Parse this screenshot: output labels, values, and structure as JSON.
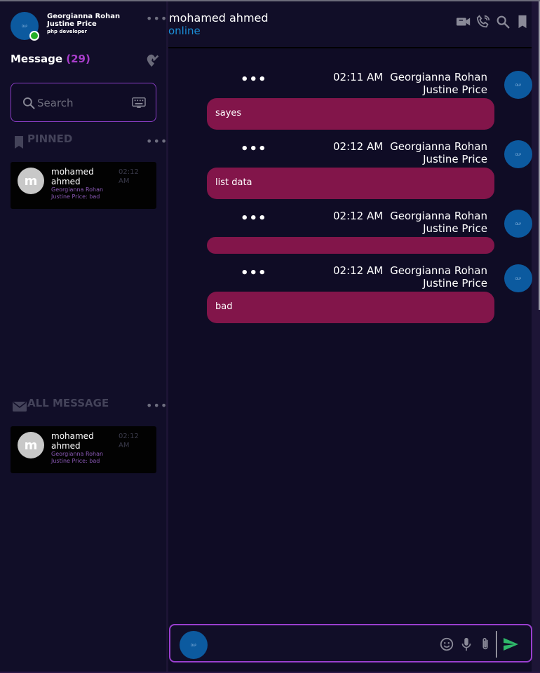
{
  "profile": {
    "name": "Georgianna Rohan Justine Price",
    "role": "php developer",
    "avatar_text": "DLP"
  },
  "sidebar": {
    "heading": "Message",
    "count": "(29)",
    "search_placeholder": "Search",
    "pinned_label": "PINNED",
    "all_label": "ALL MESSAGE",
    "pinned": [
      {
        "initial": "m",
        "name": "mohamed ahmed",
        "preview": "Georgianna Rohan Justine Price: bad",
        "time": "02:12 AM"
      }
    ],
    "all": [
      {
        "initial": "m",
        "name": "mohamed ahmed",
        "preview": "Georgianna Rohan Justine Price: bad",
        "time": "02:12 AM"
      }
    ]
  },
  "chat": {
    "contact_name": "mohamed ahmed",
    "contact_status": "online",
    "messages": [
      {
        "time": "02:11 AM",
        "sender": "Georgianna Rohan Justine Price",
        "text": "sayes"
      },
      {
        "time": "02:12 AM",
        "sender": "Georgianna Rohan Justine Price",
        "text": "list data"
      },
      {
        "time": "02:12 AM",
        "sender": "Georgianna Rohan Justine Price",
        "text": ""
      },
      {
        "time": "02:12 AM",
        "sender": "Georgianna Rohan Justine Price",
        "text": "bad"
      }
    ]
  },
  "composer": {
    "placeholder": ""
  },
  "colors": {
    "accent": "#9a3fcf",
    "bubble": "#82154a",
    "status": "#1b8fd8",
    "send": "#2fb86a"
  },
  "icons": [
    "edit-location-icon",
    "search-icon",
    "keyboard-icon",
    "bookmark-icon",
    "mail-icon",
    "video-icon",
    "phone-icon",
    "search-icon",
    "bookmark-icon",
    "emoji-icon",
    "mic-icon",
    "paperclip-icon",
    "send-icon"
  ]
}
